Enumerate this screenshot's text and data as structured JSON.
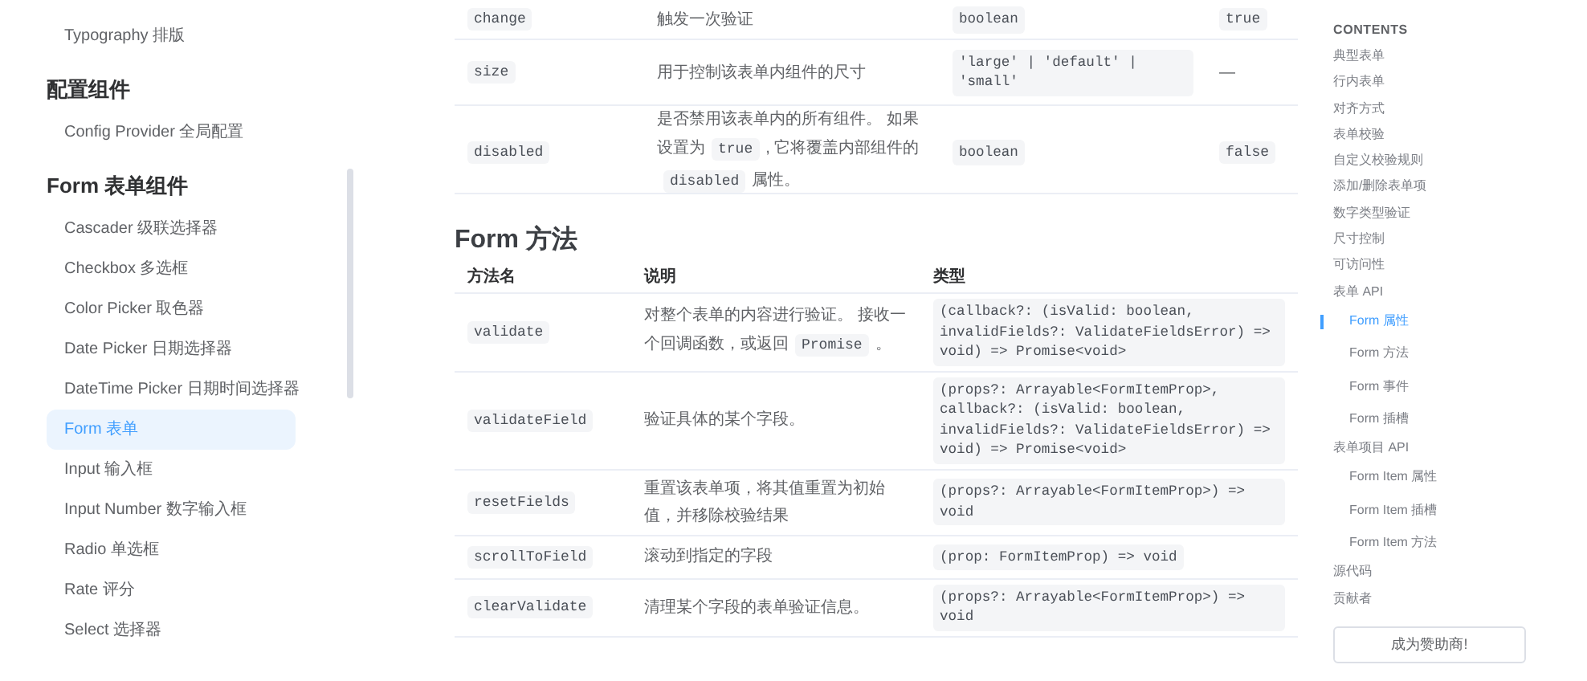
{
  "sidebar": {
    "groups": [
      {
        "items": [
          {
            "label": "Typography 排版",
            "selected": false
          }
        ]
      },
      {
        "title": "配置组件",
        "items": [
          {
            "label": "Config Provider 全局配置",
            "selected": false
          }
        ]
      },
      {
        "title": "Form 表单组件",
        "items": [
          {
            "label": "Cascader 级联选择器",
            "selected": false
          },
          {
            "label": "Checkbox 多选框",
            "selected": false
          },
          {
            "label": "Color Picker 取色器",
            "selected": false
          },
          {
            "label": "Date Picker 日期选择器",
            "selected": false
          },
          {
            "label": "DateTime Picker 日期时间选择器",
            "selected": false
          },
          {
            "label": "Form 表单",
            "selected": true
          },
          {
            "label": "Input 输入框",
            "selected": false
          },
          {
            "label": "Input Number 数字输入框",
            "selected": false
          },
          {
            "label": "Radio 单选框",
            "selected": false
          },
          {
            "label": "Rate 评分",
            "selected": false
          },
          {
            "label": "Select 选择器",
            "selected": false
          }
        ]
      }
    ]
  },
  "props_table": {
    "rows": [
      {
        "name": "change",
        "description": [
          {
            "kind": "text",
            "text": "触发一次验证"
          }
        ],
        "type": "boolean",
        "default": "true"
      },
      {
        "name": "size",
        "description": [
          {
            "kind": "text",
            "text": "用于控制该表单内组件的尺寸"
          }
        ],
        "type": "'large' | 'default' | 'small'",
        "default": "—"
      },
      {
        "name": "disabled",
        "description": [
          {
            "kind": "text",
            "text": "是否禁用该表单内的所有组件。 如果设置为"
          },
          {
            "kind": "code",
            "text": "true"
          },
          {
            "kind": "text",
            "text": ", 它将覆盖内部组件的"
          },
          {
            "kind": "code",
            "text": "disabled"
          },
          {
            "kind": "text",
            "text": "属性。"
          }
        ],
        "type": "boolean",
        "default": "false"
      }
    ]
  },
  "methods": {
    "title": "Form 方法",
    "columns": [
      "方法名",
      "说明",
      "类型"
    ],
    "rows": [
      {
        "name": "validate",
        "description": [
          {
            "kind": "text",
            "text": "对整个表单的内容进行验证。 接收一个回调函数，或返回"
          },
          {
            "kind": "code",
            "text": "Promise"
          },
          {
            "kind": "text",
            "text": "。"
          }
        ],
        "type": "(callback?: (isValid: boolean, invalidFields?: ValidateFieldsError) => void) => Promise<void>"
      },
      {
        "name": "validateField",
        "description": [
          {
            "kind": "text",
            "text": "验证具体的某个字段。"
          }
        ],
        "type": "(props?: Arrayable<FormItemProp>, callback?: (isValid: boolean, invalidFields?: ValidateFieldsError) => void) => Promise<void>"
      },
      {
        "name": "resetFields",
        "description": [
          {
            "kind": "text",
            "text": "重置该表单项，将其值重置为初始值，并移除校验结果"
          }
        ],
        "type": "(props?: Arrayable<FormItemProp>) => void"
      },
      {
        "name": "scrollToField",
        "description": [
          {
            "kind": "text",
            "text": "滚动到指定的字段"
          }
        ],
        "type": "(prop: FormItemProp) => void"
      },
      {
        "name": "clearValidate",
        "description": [
          {
            "kind": "text",
            "text": "清理某个字段的表单验证信息。"
          }
        ],
        "type": "(props?: Arrayable<FormItemProp>) => void"
      }
    ]
  },
  "toc": {
    "title": "CONTENTS",
    "items": [
      {
        "label": "典型表单",
        "selected": false
      },
      {
        "label": "行内表单",
        "selected": false
      },
      {
        "label": "对齐方式",
        "selected": false
      },
      {
        "label": "表单校验",
        "selected": false
      },
      {
        "label": "自定义校验规则",
        "selected": false
      },
      {
        "label": "添加/删除表单项",
        "selected": false
      },
      {
        "label": "数字类型验证",
        "selected": false
      },
      {
        "label": "尺寸控制",
        "selected": false
      },
      {
        "label": "可访问性",
        "selected": false
      },
      {
        "label": "表单 API",
        "selected": false,
        "children": [
          {
            "label": "Form 属性",
            "selected": true
          },
          {
            "label": "Form 方法",
            "selected": false
          },
          {
            "label": "Form 事件",
            "selected": false
          },
          {
            "label": "Form 插槽",
            "selected": false
          }
        ]
      },
      {
        "label": "表单项目 API",
        "selected": false,
        "children": [
          {
            "label": "Form Item 属性",
            "selected": false
          },
          {
            "label": "Form Item 插槽",
            "selected": false
          },
          {
            "label": "Form Item 方法",
            "selected": false
          }
        ]
      },
      {
        "label": "源代码",
        "selected": false
      },
      {
        "label": "贡献者",
        "selected": false
      }
    ]
  },
  "sponsor_button": "成为赞助商!"
}
